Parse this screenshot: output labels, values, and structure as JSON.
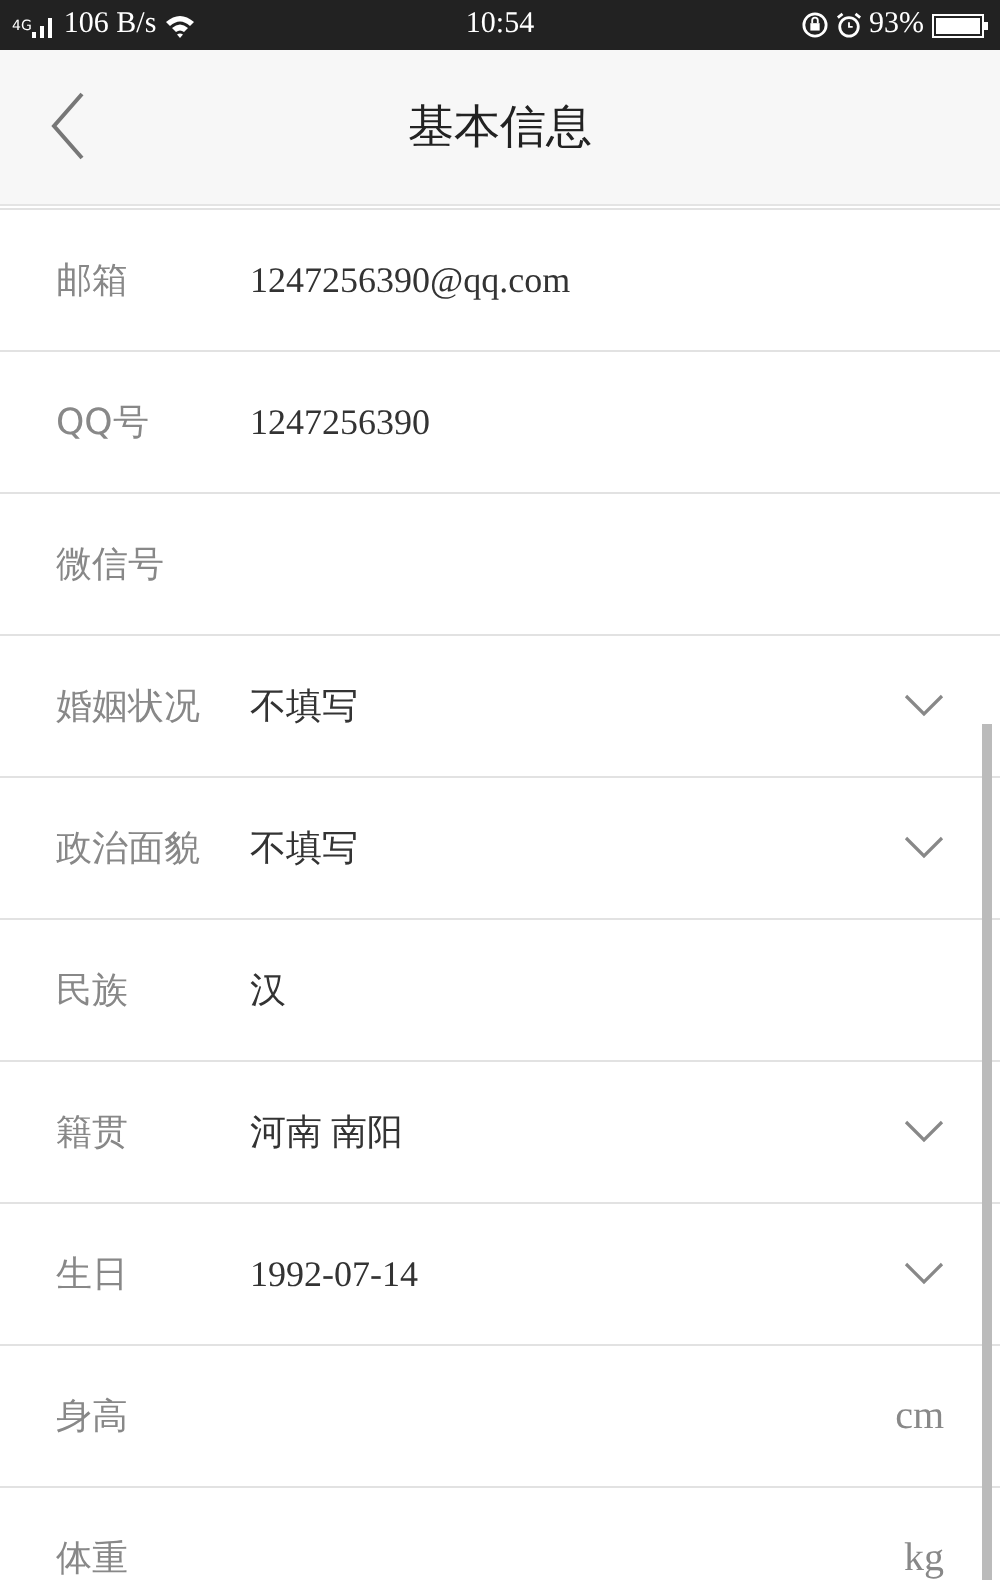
{
  "status_bar": {
    "network": "4G",
    "speed": "106 B/s",
    "time": "10:54",
    "battery": "93%"
  },
  "header": {
    "title": "基本信息"
  },
  "rows": [
    {
      "kind": "text",
      "label": "邮箱",
      "value": "1247256390@qq.com"
    },
    {
      "kind": "text",
      "label": "QQ号",
      "value": "1247256390"
    },
    {
      "kind": "text",
      "label": "微信号"
    },
    {
      "kind": "dropdown",
      "label": "婚姻状况",
      "value": "不填写"
    },
    {
      "kind": "dropdown",
      "label": "政治面貌",
      "value": "不填写"
    },
    {
      "kind": "text",
      "label": "民族",
      "value": "汉"
    },
    {
      "kind": "dropdown",
      "label": "籍贯",
      "value": "河南 南阳"
    },
    {
      "kind": "dropdown",
      "label": "生日",
      "value": "1992-07-14"
    },
    {
      "kind": "unit",
      "label": "身高",
      "unit": "cm"
    },
    {
      "kind": "unit",
      "label": "体重",
      "unit": "kg"
    }
  ]
}
